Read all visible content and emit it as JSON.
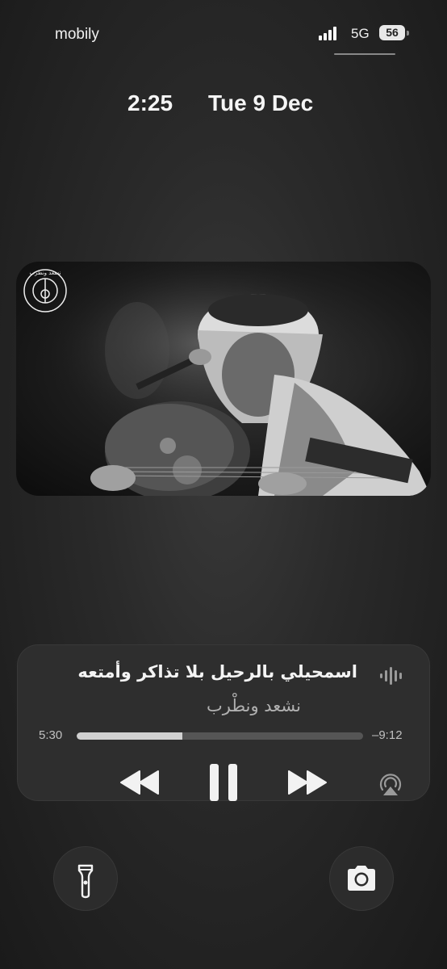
{
  "status_bar": {
    "carrier": "mobily",
    "network": "5G",
    "battery": "56"
  },
  "lock_screen": {
    "time": "2:25",
    "date": "Tue 9 Dec"
  },
  "now_playing": {
    "title": "اسمحيلي بالرحيل بلا تذاكر وأمتعه",
    "artist": "نشعد ونطْرب",
    "elapsed": "5:30",
    "remaining": "–9:12",
    "progress_fraction": 0.37,
    "artwork_logo_text": "نسعد ونطرب"
  },
  "icons": {
    "waveform": "audio-waveform-icon",
    "rewind": "rewind-icon",
    "pause": "pause-icon",
    "fast_forward": "fast-forward-icon",
    "airplay": "airplay-icon",
    "flashlight": "flashlight-icon",
    "camera": "camera-icon"
  },
  "colors": {
    "progress_fill": "#d0d0d0",
    "progress_track": "#555555",
    "player_bg": "#2e2e2e"
  }
}
